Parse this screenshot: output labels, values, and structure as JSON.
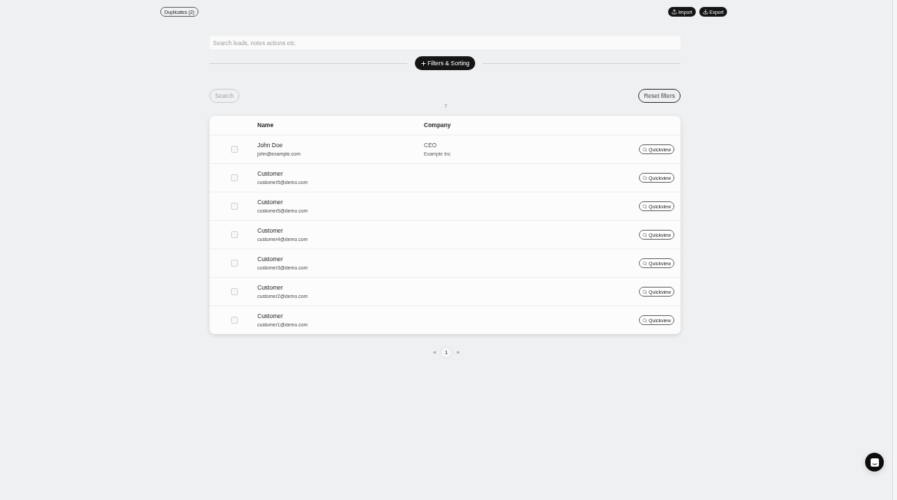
{
  "top_bar": {
    "duplicates_button": "Duplicates (2)",
    "actions": [
      {
        "label": "Import",
        "kind": "import"
      },
      {
        "label": "Export",
        "kind": "export"
      }
    ]
  },
  "search": {
    "placeholder": "Search leads, notes actions etc."
  },
  "filters_button": "Filters & Sorting",
  "search_button": {
    "label": "Search",
    "disabled": true
  },
  "reset_button": "Reset filters",
  "result_count": "7",
  "table": {
    "columns": [
      "Name",
      "Company"
    ],
    "rows": [
      {
        "name": "John Doe",
        "email": "john@example.com",
        "title": "CEO",
        "company": "Example Inc",
        "checked": false,
        "action": "Quickview"
      },
      {
        "name": "Customer",
        "email": "customer5@demo.com",
        "checked": false,
        "action": "Quickview"
      },
      {
        "name": "Customer",
        "email": "customer5@demo.com",
        "checked": false,
        "action": "Quickview"
      },
      {
        "name": "Customer",
        "email": "customer4@demo.com",
        "checked": false,
        "action": "Quickview"
      },
      {
        "name": "Customer",
        "email": "customer3@demo.com",
        "checked": false,
        "action": "Quickview"
      },
      {
        "name": "Customer",
        "email": "customer2@demo.com",
        "checked": false,
        "action": "Quickview"
      },
      {
        "name": "Customer",
        "email": "customer1@demo.com",
        "checked": false,
        "action": "Quickview"
      }
    ]
  },
  "pagination": {
    "prev": "«",
    "pages": [
      {
        "label": "1",
        "selected": true
      }
    ],
    "next": "»"
  }
}
